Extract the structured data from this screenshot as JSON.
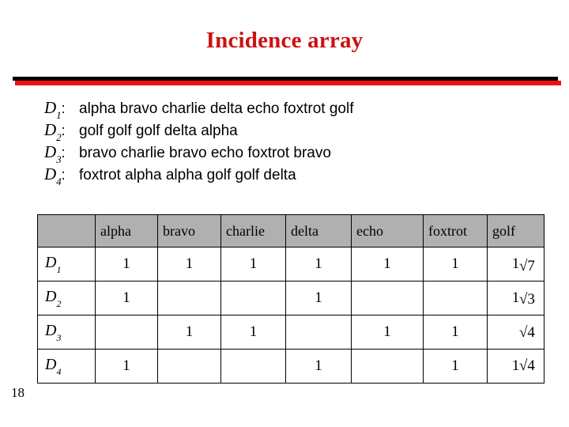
{
  "slide": {
    "title": "Incidence array",
    "page_number": "18",
    "accent_red": "#cc1111",
    "bar_black": "#000000",
    "bar_red": "#ef1111",
    "header_gray": "#b0b0b0"
  },
  "definitions": [
    {
      "label": "D",
      "subscript": "1",
      "colon": ":",
      "text": "alpha bravo charlie delta echo foxtrot golf"
    },
    {
      "label": "D",
      "subscript": "2",
      "colon": ":",
      "text": "golf golf golf delta alpha"
    },
    {
      "label": "D",
      "subscript": "3",
      "colon": ":",
      "text": "bravo charlie bravo echo foxtrot bravo"
    },
    {
      "label": "D",
      "subscript": "4",
      "colon": ":",
      "text": "foxtrot alpha alpha golf golf delta"
    }
  ],
  "table": {
    "corner_header": "",
    "columns": [
      "alpha",
      "bravo",
      "charlie",
      "delta",
      "echo",
      "foxtrot",
      "golf"
    ],
    "rows": [
      {
        "label": "D",
        "subscript": "1",
        "cells": [
          "1",
          "1",
          "1",
          "1",
          "1",
          "1",
          "1"
        ]
      },
      {
        "label": "D",
        "subscript": "2",
        "cells": [
          "1",
          "",
          "",
          "1",
          "",
          "",
          "1"
        ]
      },
      {
        "label": "D",
        "subscript": "3",
        "cells": [
          "",
          "1",
          "1",
          "",
          "1",
          "1",
          ""
        ]
      },
      {
        "label": "D",
        "subscript": "4",
        "cells": [
          "1",
          "",
          "",
          "1",
          "",
          "1",
          "1"
        ]
      }
    ]
  },
  "norms": [
    {
      "text": "√7"
    },
    {
      "text": "√3"
    },
    {
      "text": "√4"
    },
    {
      "text": "√4"
    }
  ]
}
